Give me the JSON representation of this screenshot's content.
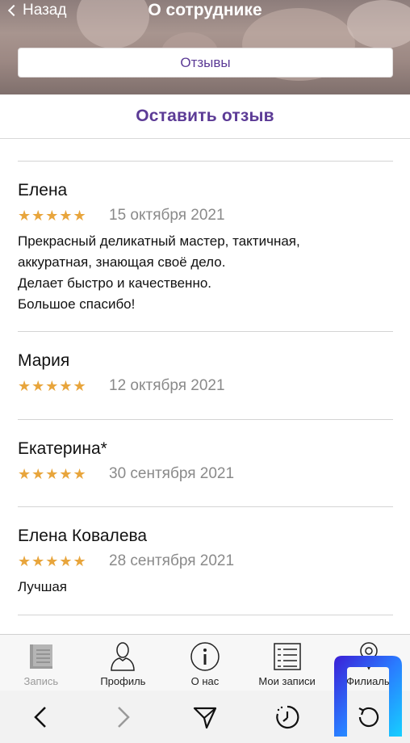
{
  "header": {
    "back_label": "Назад",
    "title": "О сотруднике",
    "tab_label": "Отзывы"
  },
  "leave_review_label": "Оставить отзыв",
  "reviews": [
    {
      "name": "Елена",
      "stars": "★★★★★",
      "rating": 5,
      "date": "15 октября 2021",
      "text_lines": [
        "Прекрасный деликатный мастер, тактичная,",
        "аккуратная, знающая своё дело.",
        "Делает быстро и качественно.",
        "Большое спасибо!"
      ]
    },
    {
      "name": "Мария",
      "stars": "★★★★★",
      "rating": 5,
      "date": "12 октября 2021",
      "text_lines": []
    },
    {
      "name": "Екатерина*",
      "stars": "★★★★★",
      "rating": 5,
      "date": "30 сентября 2021",
      "text_lines": []
    },
    {
      "name": "Елена Ковалева",
      "stars": "★★★★★",
      "rating": 5,
      "date": "28 сентября 2021",
      "text_lines": [
        "Лучшая"
      ]
    }
  ],
  "tabbar": {
    "items": [
      {
        "label": "Запись",
        "icon": "book-icon"
      },
      {
        "label": "Профиль",
        "icon": "user-icon"
      },
      {
        "label": "О нас",
        "icon": "info-icon"
      },
      {
        "label": "Мои записи",
        "icon": "list-icon"
      },
      {
        "label": "Филиалы",
        "icon": "location-icon"
      }
    ]
  },
  "browser_toolbar": {
    "items": [
      "back-icon",
      "forward-icon",
      "send-icon",
      "history-icon",
      "reload-icon"
    ]
  },
  "colors": {
    "accent": "#5c3b96",
    "star": "#e8a53c",
    "date": "#8a8a8a"
  }
}
